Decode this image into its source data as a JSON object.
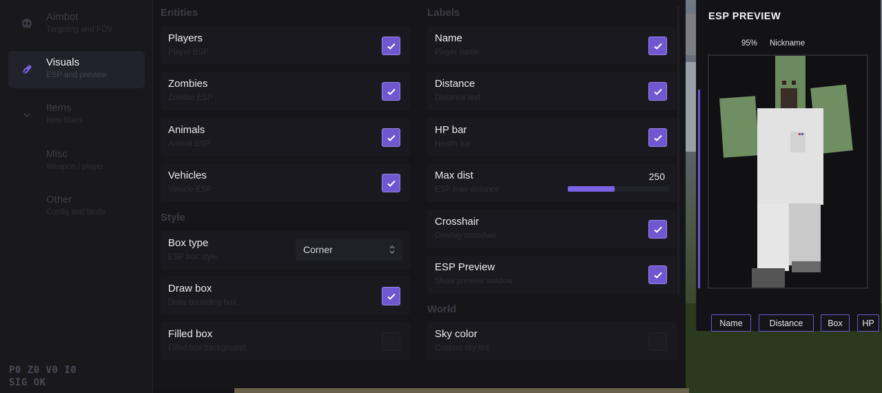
{
  "sidebar": {
    "items": [
      {
        "title": "Aimbot",
        "subtitle": "Targeting and FOV",
        "icon": "skull-icon"
      },
      {
        "title": "Visuals",
        "subtitle": "ESP and preview",
        "icon": "pen-nib-icon"
      },
      {
        "title": "Items",
        "subtitle": "Item filters",
        "icon": "chevron-down-icon"
      },
      {
        "title": "Misc",
        "subtitle": "Weapon / player",
        "icon": ""
      },
      {
        "title": "Other",
        "subtitle": "Config and binds",
        "icon": ""
      }
    ],
    "status_line1": "P0 Z0 V0 I0",
    "status_line2": "SIG OK"
  },
  "entities": {
    "title": "Entities",
    "rows": [
      {
        "title": "Players",
        "subtitle": "Player ESP",
        "checked": true
      },
      {
        "title": "Zombies",
        "subtitle": "Zombie ESP",
        "checked": true
      },
      {
        "title": "Animals",
        "subtitle": "Animal ESP",
        "checked": true
      },
      {
        "title": "Vehicles",
        "subtitle": "Vehicle ESP",
        "checked": true
      }
    ]
  },
  "style": {
    "title": "Style",
    "box_type": {
      "title": "Box type",
      "subtitle": "ESP box style",
      "value": "Corner"
    },
    "draw_box": {
      "title": "Draw box",
      "subtitle": "Draw bounding box",
      "checked": true
    },
    "filled_box": {
      "title": "Filled box",
      "subtitle": "Filled box background",
      "checked": false
    }
  },
  "labels": {
    "title": "Labels",
    "name": {
      "title": "Name",
      "subtitle": "Player name",
      "checked": true
    },
    "distance": {
      "title": "Distance",
      "subtitle": "Distance text",
      "checked": true
    },
    "hp_bar": {
      "title": "HP bar",
      "subtitle": "Health bar",
      "checked": true
    },
    "max_dist": {
      "title": "Max dist",
      "subtitle": "ESP max distance",
      "value": "250",
      "fraction": 0.46
    },
    "crosshair": {
      "title": "Crosshair",
      "subtitle": "Overlay crosshair",
      "checked": true
    },
    "esp_preview": {
      "title": "ESP Preview",
      "subtitle": "Show preview window",
      "checked": true
    }
  },
  "world": {
    "title": "World",
    "sky_color": {
      "title": "Sky color",
      "subtitle": "Custom sky tint",
      "checked": false
    }
  },
  "preview": {
    "title": "ESP PREVIEW",
    "health_pct": "95%",
    "nickname": "Nickname",
    "tags": [
      "Name",
      "Distance",
      "Box",
      "HP"
    ]
  },
  "colors": {
    "accent": "#6e57cf",
    "accent_light": "#9b88ee",
    "bg": "#15151a",
    "row": "#19191f"
  }
}
